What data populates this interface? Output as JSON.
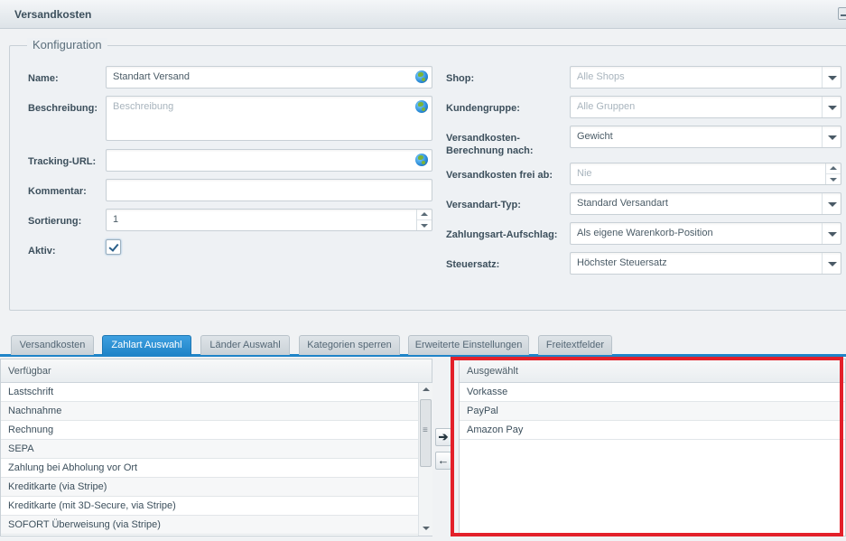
{
  "window": {
    "title": "Versandkosten"
  },
  "fieldset": {
    "legend": "Konfiguration"
  },
  "left_form": {
    "name": {
      "label": "Name:",
      "value": "Standart Versand"
    },
    "beschreibung": {
      "label": "Beschreibung:",
      "placeholder": "Beschreibung"
    },
    "tracking_url": {
      "label": "Tracking-URL:",
      "value": ""
    },
    "kommentar": {
      "label": "Kommentar:",
      "value": ""
    },
    "sortierung": {
      "label": "Sortierung:",
      "value": "1"
    },
    "aktiv": {
      "label": "Aktiv:",
      "checked": true
    }
  },
  "right_form": {
    "shop": {
      "label": "Shop:",
      "placeholder": "Alle Shops"
    },
    "kundengruppe": {
      "label": "Kundengruppe:",
      "placeholder": "Alle Gruppen"
    },
    "berechnung": {
      "label_line1": "Versandkosten-",
      "label_line2": "Berechnung nach:",
      "value": "Gewicht"
    },
    "frei_ab": {
      "label": "Versandkosten frei ab:",
      "placeholder": "Nie"
    },
    "versandart_typ": {
      "label": "Versandart-Typ:",
      "value": "Standard Versandart"
    },
    "aufschlag": {
      "label": "Zahlungsart-Aufschlag:",
      "value": "Als eigene Warenkorb-Position"
    },
    "steuersatz": {
      "label": "Steuersatz:",
      "value": "Höchster Steuersatz"
    }
  },
  "tabs": [
    {
      "label": "Versandkosten",
      "active": false
    },
    {
      "label": "Zahlart Auswahl",
      "active": true
    },
    {
      "label": "Länder Auswahl",
      "active": false
    },
    {
      "label": "Kategorien sperren",
      "active": false
    },
    {
      "label": "Erweiterte Einstellungen",
      "active": false
    },
    {
      "label": "Freitextfelder",
      "active": false
    }
  ],
  "available": {
    "header": "Verfügbar",
    "items": [
      "Lastschrift",
      "Nachnahme",
      "Rechnung",
      "SEPA",
      "Zahlung bei Abholung vor Ort",
      "Kreditkarte (via Stripe)",
      "Kreditkarte (mit 3D-Secure, via Stripe)",
      "SOFORT Überweisung (via Stripe)"
    ]
  },
  "selected": {
    "header": "Ausgewählt",
    "items": [
      "Vorkasse",
      "PayPal",
      "Amazon Pay"
    ]
  },
  "move_buttons": {
    "add": "➔",
    "remove": "←"
  },
  "colors": {
    "accent": "#1f84c8",
    "highlight": "#e3202a"
  }
}
